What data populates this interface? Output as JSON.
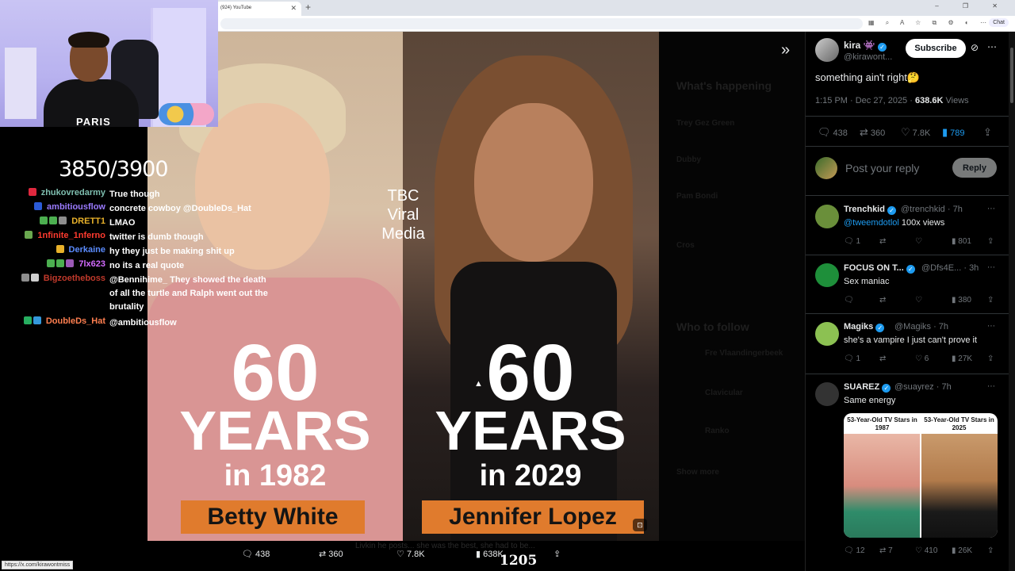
{
  "browser": {
    "tab_title": "(924) YouTube",
    "chat_label": "Chat",
    "window_controls": "– ❐ ✕"
  },
  "webcam": {
    "shirt_text": "PARIS"
  },
  "stream": {
    "counter": "3850/3900",
    "viewers": "1205",
    "status_url": "https://x.com/kirawontmiss"
  },
  "chat_messages": [
    {
      "user": "zhukovredarmy",
      "color": "#7fbfb0",
      "message": "True though",
      "badges": [
        "#e0283e"
      ]
    },
    {
      "user": "ambitiousflow",
      "color": "#9b7bff",
      "message": "concrete cowboy @DoubleDs_Hat",
      "badges": [
        "#2b5bd7"
      ]
    },
    {
      "user": "DRETT1",
      "color": "#e8b12a",
      "message": "LMAO",
      "badges": [
        "#4caf50",
        "#4caf50",
        "#8d8d8d"
      ]
    },
    {
      "user": "1nfinite_1nferno",
      "color": "#ff3b2f",
      "message": "twitter is dumb though",
      "badges": [
        "#6aa84f"
      ]
    },
    {
      "user": "Derkaine",
      "color": "#5b8cff",
      "message": "hy they just be making shit up",
      "badges": [
        "#e8b12a"
      ]
    },
    {
      "user": "7lx623",
      "color": "#d36bff",
      "message": "no its a real quote",
      "badges": [
        "#4caf50",
        "#4caf50",
        "#9b59b6"
      ]
    },
    {
      "user": "Bigzoetheboss",
      "color": "#c0392b",
      "message": "@Bennihime_ They showed the death of all the turtle and Ralph went out the brutality",
      "badges": [
        "#8d8d8d",
        "#cfcfcf"
      ]
    },
    {
      "user": "DoubleDs_Hat",
      "color": "#ff7f50",
      "message": "@ambitiousflow",
      "badges": [
        "#27ae60",
        "#3498db"
      ]
    }
  ],
  "video": {
    "watermark": "TBC Viral Media",
    "left": {
      "number": "60",
      "years": "YEARS",
      "in_year": "in 1982",
      "name": "Betty White"
    },
    "right": {
      "number": "60",
      "years": "YEARS",
      "in_year": "in 2029",
      "name": "Jennifer Lopez"
    },
    "colors": {
      "nameplate": "#e07b2d",
      "left_bg": "#d99594",
      "right_bg": "#1b1715"
    }
  },
  "dimmed_sidebar": {
    "headline": "What's happening",
    "trend_1": "Trey Gez Green",
    "trend_2": "Dubby",
    "trend_3": "Pam Bondi",
    "trend_4": "Cros",
    "who_to_follow": "Who to follow",
    "follow_1": "Fre Vlaandingerbeek",
    "follow_2": "Clavicular",
    "follow_3": "Ranko",
    "show_more": "Show more",
    "caption": "Livkin he posts... she was the best, she had to be..."
  },
  "bottom_actions": {
    "replies": "438",
    "reposts": "360",
    "likes": "7.8K",
    "views": "638K"
  },
  "post": {
    "author_name": "kira",
    "author_handle": "@kirawont...",
    "subscribe_label": "Subscribe",
    "text": "something ain't right🤔",
    "timestamp": "1:15 PM · Dec 27, 2025 · ",
    "views_count": "638.6K",
    "views_label": " Views",
    "replies": "438",
    "reposts": "360",
    "likes": "7.8K",
    "bookmarks": "789",
    "reply_placeholder": "Post your reply",
    "reply_button": "Reply"
  },
  "replies": [
    {
      "name": "Trenchkid",
      "handle": "@trenchkid · 7h",
      "mention": "@tweemdotlol",
      "text": " 100x views",
      "replies": "1",
      "reposts": "",
      "likes": "",
      "views": "801"
    },
    {
      "name": "FOCUS ON T...",
      "handle": "@Dfs4E... · 3h",
      "mention": "",
      "text": "Sex maniac",
      "replies": "",
      "reposts": "",
      "likes": "",
      "views": "380"
    },
    {
      "name": "Magiks",
      "handle": "@Magiks · 7h",
      "mention": "",
      "text": "she's a vampire I just can't prove it",
      "replies": "1",
      "reposts": "",
      "likes": "6",
      "views": "27K"
    },
    {
      "name": "SUAREZ",
      "handle": "@suayrez · 7h",
      "mention": "",
      "text": "Same energy",
      "replies": "12",
      "reposts": "7",
      "likes": "410",
      "views": "26K"
    }
  ],
  "embedded_image": {
    "left_caption": "53-Year-Old TV Stars in 1987",
    "right_caption": "53-Year-Old TV Stars in 2025"
  },
  "icons": {
    "reply": "reply-icon",
    "repost": "repost-icon",
    "like": "heart-icon",
    "bookmark": "bookmark-icon",
    "share": "share-icon",
    "views": "views-icon"
  }
}
